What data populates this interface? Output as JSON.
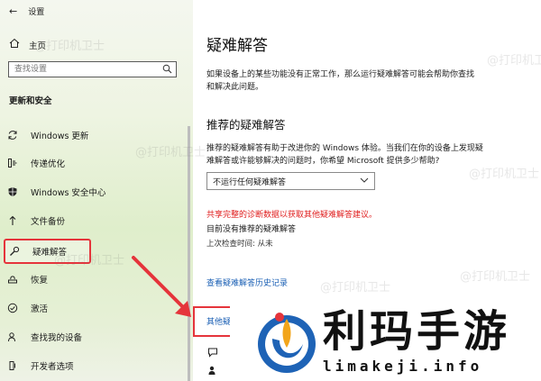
{
  "window": {
    "title": "设置"
  },
  "sidebar": {
    "home_label": "主页",
    "search_placeholder": "查找设置",
    "section_title": "更新和安全",
    "items": [
      {
        "label": "Windows 更新",
        "icon": "sync-icon"
      },
      {
        "label": "传递优化",
        "icon": "delivery-optimization-icon"
      },
      {
        "label": "Windows 安全中心",
        "icon": "shield-icon"
      },
      {
        "label": "文件备份",
        "icon": "backup-arrow-icon"
      },
      {
        "label": "疑难解答",
        "icon": "wrench-icon",
        "selected": true
      },
      {
        "label": "恢复",
        "icon": "recovery-icon"
      },
      {
        "label": "激活",
        "icon": "check-circle-icon"
      },
      {
        "label": "查找我的设备",
        "icon": "person-pin-icon"
      },
      {
        "label": "开发者选项",
        "icon": "developer-icon"
      }
    ]
  },
  "main": {
    "title": "疑难解答",
    "intro": "如果设备上的某些功能没有正常工作，那么运行疑难解答可能会帮助你查找和解决此问题。",
    "recommended_heading": "推荐的疑难解答",
    "recommended_desc": "推荐的疑难解答有助于改进你的 Windows 体验。当我们在你的设备上发现疑难解答或许能够解决的问题时，你希望 Microsoft 提供多少帮助?",
    "dropdown_value": "不运行任何疑难解答",
    "warning": "共享完整的诊断数据以获取其他疑难解答建议。",
    "no_recommended": "目前没有推荐的疑难解答",
    "last_checked": "上次检查时间: 从未",
    "history_link": "查看疑难解答历史记录",
    "other_label": "其他疑"
  },
  "watermark": "@打印机卫士",
  "overlay_logo": {
    "cn": "利玛手游",
    "en": "limakeji.info"
  },
  "colors": {
    "highlight": "#e5343b",
    "link": "#1a5fb4",
    "warning": "#e02020"
  }
}
